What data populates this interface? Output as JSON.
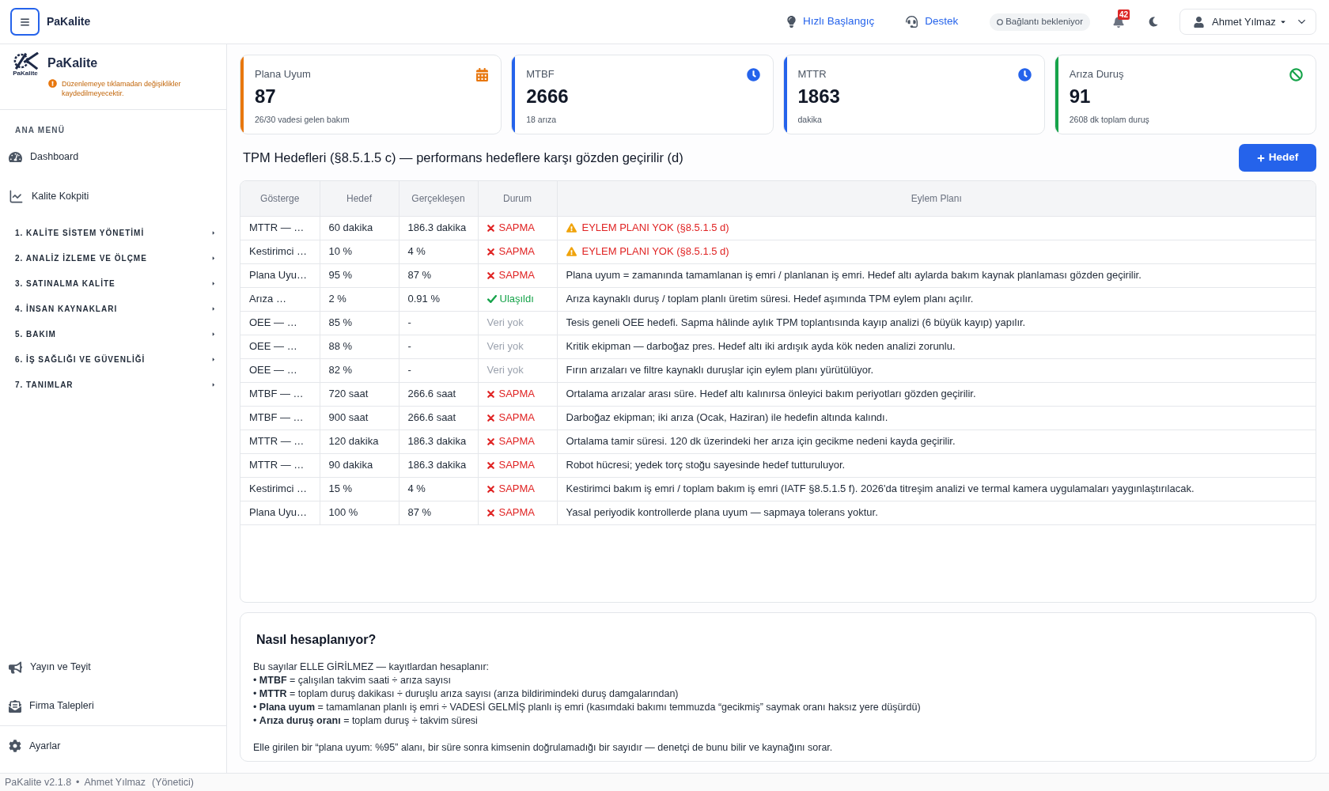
{
  "topbar": {
    "brand": "PaKalite",
    "links": [
      {
        "label": "Hızlı Başlangıç",
        "kind": "bulb"
      },
      {
        "label": "Destek",
        "kind": "headset"
      }
    ],
    "connection_status": "Bağlantı bekleniyor",
    "notification_count": "42",
    "user": "Ahmet Yılmaz"
  },
  "sidebar": {
    "logo_caption": "PaKalite",
    "brand": "PaKalite",
    "warning": "Düzenlemeye tıklamadan değişiklikler kaydedilmeyecektir.",
    "menu_title": "ANA MENÜ",
    "items": [
      {
        "label": "Dashboard",
        "kind": "dashboard"
      },
      {
        "label": "Kalite Kokpiti",
        "kind": "chart"
      }
    ],
    "groups": [
      {
        "label": "1. KALİTE SİSTEM YÖNETİMİ"
      },
      {
        "label": "2. ANALİZ İZLEME VE ÖLÇME"
      },
      {
        "label": "3. SATINALMA KALİTE"
      },
      {
        "label": "4. İNSAN KAYNAKLARI"
      },
      {
        "label": "5. BAKIM"
      },
      {
        "label": "6. İŞ SAĞLIĞI VE GÜVENLİĞİ"
      },
      {
        "label": "7. TANIMLAR"
      }
    ],
    "bottom_items": [
      {
        "label": "Yayın ve Teyit",
        "kind": "megaphone"
      },
      {
        "label": "Firma Talepleri",
        "kind": "mail"
      }
    ],
    "footer_item": {
      "label": "Ayarlar",
      "kind": "gear"
    }
  },
  "kpis": [
    {
      "title": "Plana Uyum",
      "value": "87",
      "subtitle": "26/30 vadesi gelen bakım",
      "color": "#e8770e",
      "kind": "calendar"
    },
    {
      "title": "MTBF",
      "value": "2666",
      "subtitle": "18 arıza",
      "color": "#2563eb",
      "kind": "clock"
    },
    {
      "title": "MTTR",
      "value": "1863",
      "subtitle": "dakika",
      "color": "#2563eb",
      "kind": "clock"
    },
    {
      "title": "Arıza Duruş",
      "value": "91",
      "subtitle": "2608 dk toplam duruş",
      "color": "#16a34a",
      "kind": "ban"
    }
  ],
  "section": {
    "title": "TPM Hedefleri (§8.5.1.5 c) — performans hedeflere karşı gözden geçirilir (d)",
    "add_button": "Hedef"
  },
  "table": {
    "columns": [
      "Gösterge",
      "Hedef",
      "Gerçekleşen",
      "Durum",
      "Eylem Planı"
    ],
    "rows": [
      {
        "indicator": "MTTR — …",
        "target": "60 dakika",
        "actual": "186.3 dakika",
        "status": {
          "kind": "deviation",
          "label": "SAPMA"
        },
        "plan": {
          "kind": "warning",
          "text": "EYLEM PLANI YOK (§8.5.1.5 d)"
        }
      },
      {
        "indicator": "Kestirimci …",
        "target": "10 %",
        "actual": "4 %",
        "status": {
          "kind": "deviation",
          "label": "SAPMA"
        },
        "plan": {
          "kind": "warning",
          "text": "EYLEM PLANI YOK (§8.5.1.5 d)"
        }
      },
      {
        "indicator": "Plana Uyu…",
        "target": "95 %",
        "actual": "87 %",
        "status": {
          "kind": "deviation",
          "label": "SAPMA"
        },
        "plan": {
          "kind": "text",
          "text": "Plana uyum = zamanında tamamlanan iş emri / planlanan iş emri. Hedef altı aylarda bakım kaynak planlaması gözden geçirilir."
        }
      },
      {
        "indicator": "Arıza …",
        "target": "2 %",
        "actual": "0.91 %",
        "status": {
          "kind": "achieved",
          "label": "Ulaşıldı"
        },
        "plan": {
          "kind": "text",
          "text": "Arıza kaynaklı duruş / toplam planlı üretim süresi. Hedef aşımında TPM eylem planı açılır."
        }
      },
      {
        "indicator": "OEE — …",
        "target": "85 %",
        "actual": "-",
        "status": {
          "kind": "no_data",
          "label": "Veri yok"
        },
        "plan": {
          "kind": "text",
          "text": "Tesis geneli OEE hedefi. Sapma hâlinde aylık TPM toplantısında kayıp analizi (6 büyük kayıp) yapılır."
        }
      },
      {
        "indicator": "OEE — …",
        "target": "88 %",
        "actual": "-",
        "status": {
          "kind": "no_data",
          "label": "Veri yok"
        },
        "plan": {
          "kind": "text",
          "text": "Kritik ekipman — darboğaz pres. Hedef altı iki ardışık ayda kök neden analizi zorunlu."
        }
      },
      {
        "indicator": "OEE — …",
        "target": "82 %",
        "actual": "-",
        "status": {
          "kind": "no_data",
          "label": "Veri yok"
        },
        "plan": {
          "kind": "text",
          "text": "Fırın arızaları ve filtre kaynaklı duruşlar için eylem planı yürütülüyor."
        }
      },
      {
        "indicator": "MTBF — …",
        "target": "720 saat",
        "actual": "266.6 saat",
        "status": {
          "kind": "deviation",
          "label": "SAPMA"
        },
        "plan": {
          "kind": "text",
          "text": "Ortalama arızalar arası süre. Hedef altı kalınırsa önleyici bakım periyotları gözden geçirilir."
        }
      },
      {
        "indicator": "MTBF — …",
        "target": "900 saat",
        "actual": "266.6 saat",
        "status": {
          "kind": "deviation",
          "label": "SAPMA"
        },
        "plan": {
          "kind": "text",
          "text": "Darboğaz ekipman; iki arıza (Ocak, Haziran) ile hedefin altında kalındı."
        }
      },
      {
        "indicator": "MTTR — …",
        "target": "120 dakika",
        "actual": "186.3 dakika",
        "status": {
          "kind": "deviation",
          "label": "SAPMA"
        },
        "plan": {
          "kind": "text",
          "text": "Ortalama tamir süresi. 120 dk üzerindeki her arıza için gecikme nedeni kayda geçirilir."
        }
      },
      {
        "indicator": "MTTR — …",
        "target": "90 dakika",
        "actual": "186.3 dakika",
        "status": {
          "kind": "deviation",
          "label": "SAPMA"
        },
        "plan": {
          "kind": "text",
          "text": "Robot hücresi; yedek torç stoğu sayesinde hedef tutturuluyor."
        }
      },
      {
        "indicator": "Kestirimci …",
        "target": "15 %",
        "actual": "4 %",
        "status": {
          "kind": "deviation",
          "label": "SAPMA"
        },
        "plan": {
          "kind": "text",
          "text": "Kestirimci bakım iş emri / toplam bakım iş emri (IATF §8.5.1.5 f). 2026'da titreşim analizi ve termal kamera uygulamaları yaygınlaştırılacak."
        }
      },
      {
        "indicator": "Plana Uyu…",
        "target": "100 %",
        "actual": "87 %",
        "status": {
          "kind": "deviation",
          "label": "SAPMA"
        },
        "plan": {
          "kind": "text",
          "text": "Yasal periyodik kontrollerde plana uyum — sapmaya tolerans yoktur."
        }
      }
    ]
  },
  "explanation": {
    "title": "Nasıl hesaplanıyor?",
    "intro": "Bu sayılar ELLE GİRİLMEZ — kayıtlardan hesaplanır:",
    "bullets": [
      "• **MTBF** = çalışılan takvim saati ÷ arıza sayısı",
      "• **MTTR** = toplam duruş dakikası ÷ duruşlu arıza sayısı (arıza bildirimindeki duruş damgalarından)",
      "• **Plana uyum** = tamamlanan planlı iş emri ÷ VADESİ GELMİŞ planlı iş emri (kasımdaki bakımı temmuzda “gecikmiş” saymak oranı haksız yere düşürdü)",
      "• **Arıza duruş oranı** = toplam duruş ÷ takvim süresi"
    ],
    "note": "Elle girilen bir “plana uyum: %95” alanı, bir süre sonra kimsenin doğrulamadığı bir sayıdır — denetçi de bunu bilir ve kaynağını sorar."
  },
  "footer": {
    "version": "PaKalite v2.1.8",
    "separator": "•",
    "user": "Ahmet Yılmaz",
    "role": "(Yönetici)"
  }
}
